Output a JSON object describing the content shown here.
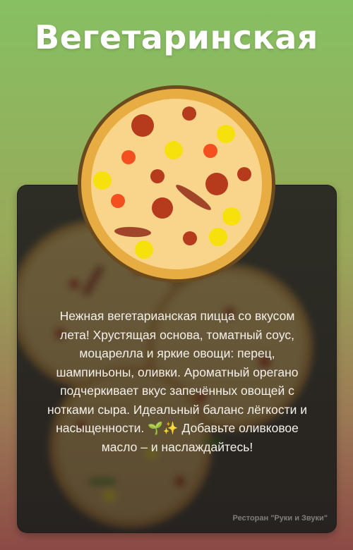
{
  "title": "Вегетаринская",
  "description": "Нежная вегетарианская пицца со вкусом лета! Хрустящая основа, томатный соус, моцарелла и яркие овощи: перец, шампиньоны, оливки. Ароматный орегано подчеркивает вкус запечённых овощей с нотками сыра. Идеальный баланс лёгкости и насыщенности. 🌱✨ Добавьте оливковое масло – и наслаждайтесь!",
  "footer": "Ресторан \"Руки и Звуки\"",
  "colors": {
    "crust": "#e7ac42",
    "crust_edge": "#6b4a1d",
    "cheese": "#f8d58a",
    "tomato": "#b63a1c",
    "pepper": "#f7e10d",
    "orange": "#f4501f",
    "sausage": "#a0452a"
  },
  "icons": [
    "pizza-icon",
    "seedling-emoji",
    "sparkles-emoji"
  ]
}
